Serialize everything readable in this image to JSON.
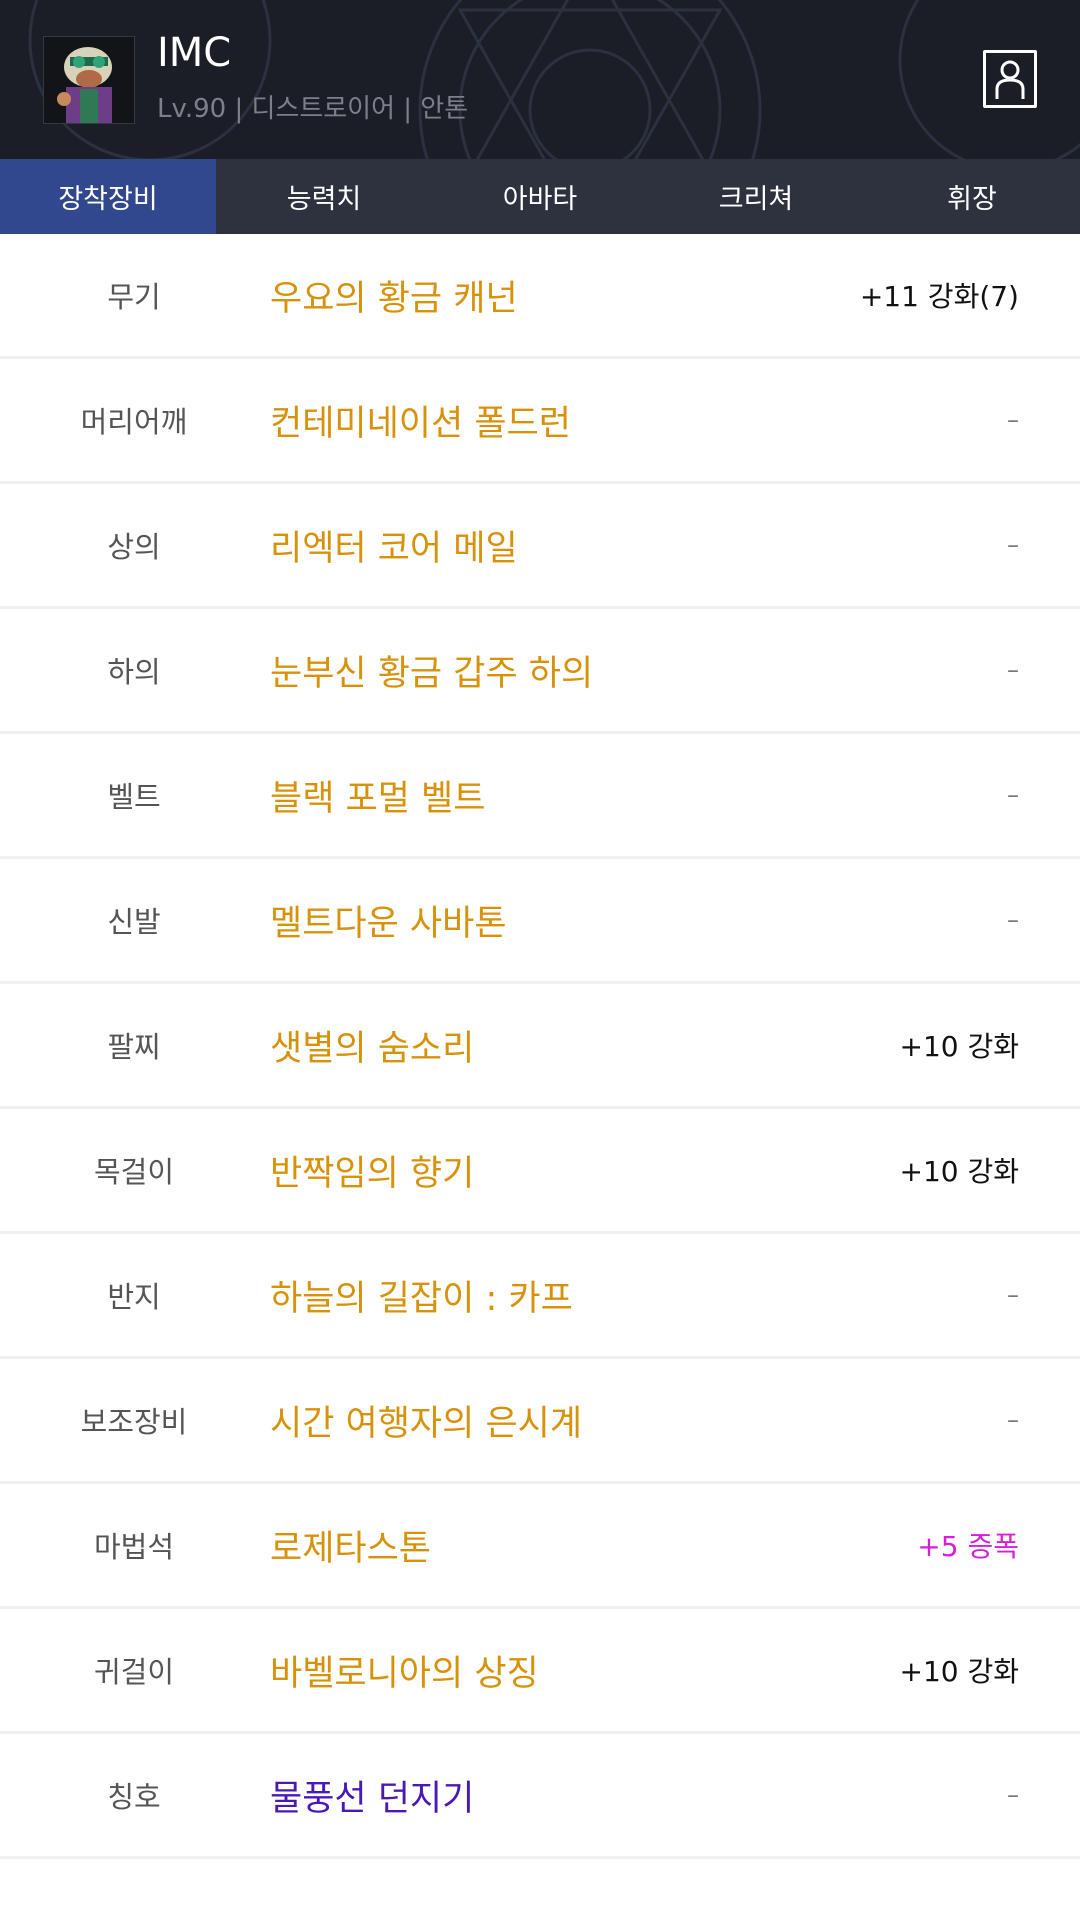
{
  "header": {
    "title": "IMC",
    "subtitle": "Lv.90 | 디스트로이어 | 안톤",
    "avatar_icon": "character-portrait",
    "profile_icon": "person-icon"
  },
  "tabs": [
    {
      "label": "장착장비",
      "active": true
    },
    {
      "label": "능력치",
      "active": false
    },
    {
      "label": "아바타",
      "active": false
    },
    {
      "label": "크리쳐",
      "active": false
    },
    {
      "label": "휘장",
      "active": false
    }
  ],
  "colors": {
    "item_name": "#d8920a",
    "title_item": "#4a18b4",
    "amplify": "#d71fd7",
    "active_tab": "#32488e"
  },
  "equipment": [
    {
      "slot": "무기",
      "name": "우요의 황금 캐넌",
      "note": "+11 강화(7)"
    },
    {
      "slot": "머리어깨",
      "name": "컨테미네이션 폴드런",
      "note": "–"
    },
    {
      "slot": "상의",
      "name": "리엑터 코어 메일",
      "note": "–"
    },
    {
      "slot": "하의",
      "name": "눈부신 황금 갑주 하의",
      "note": "–"
    },
    {
      "slot": "벨트",
      "name": "블랙 포멀 벨트",
      "note": "–"
    },
    {
      "slot": "신발",
      "name": "멜트다운 사바톤",
      "note": "–"
    },
    {
      "slot": "팔찌",
      "name": "샛별의 숨소리",
      "note": "+10 강화"
    },
    {
      "slot": "목걸이",
      "name": "반짝임의 향기",
      "note": "+10 강화"
    },
    {
      "slot": "반지",
      "name": "하늘의 길잡이 : 카프",
      "note": "–"
    },
    {
      "slot": "보조장비",
      "name": "시간 여행자의 은시계",
      "note": "–"
    },
    {
      "slot": "마법석",
      "name": "로제타스톤",
      "note": "+5 증폭"
    },
    {
      "slot": "귀걸이",
      "name": "바벨로니아의 상징",
      "note": "+10 강화"
    },
    {
      "slot": "칭호",
      "name": "물풍선 던지기",
      "note": "–"
    }
  ]
}
